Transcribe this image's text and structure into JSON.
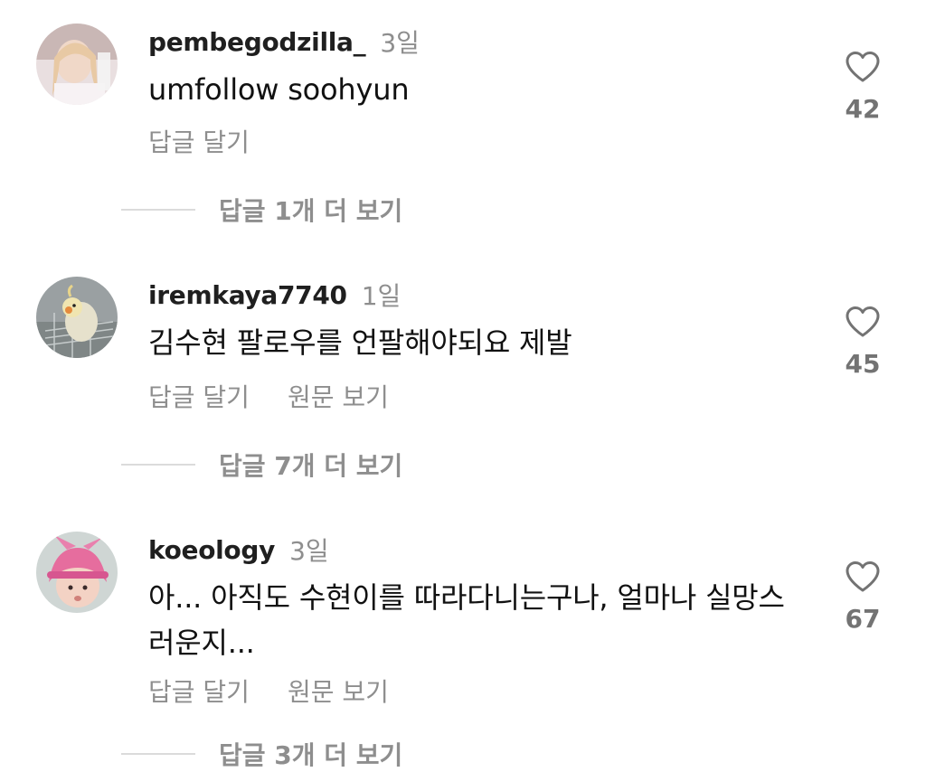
{
  "comments": [
    {
      "username": "pembegodzilla_",
      "time": "3일",
      "text": "umfollow soohyun",
      "actions": [
        "답글 달기"
      ],
      "likes": "42",
      "more_replies": "답글 1개 더 보기"
    },
    {
      "username": "iremkaya7740",
      "time": "1일",
      "text": "김수현 팔로우를 언팔해야되요 제발",
      "actions": [
        "답글 달기",
        "원문 보기"
      ],
      "likes": "45",
      "more_replies": "답글 7개 더 보기"
    },
    {
      "username": "koeology",
      "time": "3일",
      "text": "아... 아직도 수현이를 따라다니는구나, 얼마나 실망스러운지...",
      "actions": [
        "답글 달기",
        "원문 보기"
      ],
      "likes": "67",
      "more_replies": "답글 3개 더 보기"
    }
  ],
  "icons": {
    "like": "heart-outline-icon"
  },
  "colors": {
    "text": "#111111",
    "secondary": "#8e8e8e",
    "like_count": "#737373",
    "divider": "#dbdbdb"
  }
}
